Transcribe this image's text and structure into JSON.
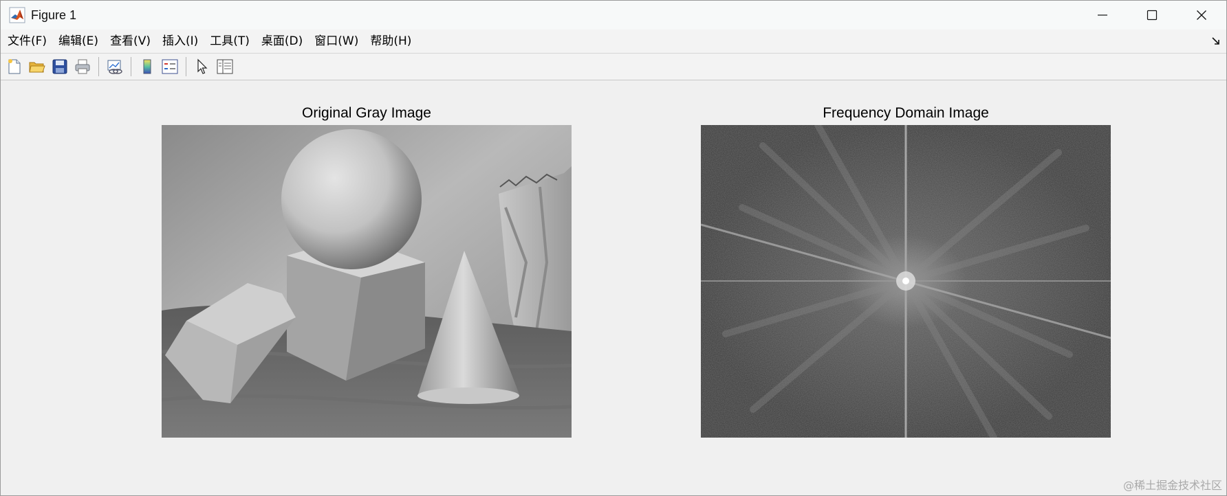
{
  "window": {
    "title": "Figure 1"
  },
  "menubar": {
    "items": [
      {
        "label": "文件(F)"
      },
      {
        "label": "编辑(E)"
      },
      {
        "label": "查看(V)"
      },
      {
        "label": "插入(I)"
      },
      {
        "label": "工具(T)"
      },
      {
        "label": "桌面(D)"
      },
      {
        "label": "窗口(W)"
      },
      {
        "label": "帮助(H)"
      }
    ]
  },
  "toolbar": {
    "icons": [
      "new-figure-icon",
      "open-file-icon",
      "save-icon",
      "print-icon",
      "link-plot-icon",
      "insert-colorbar-icon",
      "insert-legend-icon",
      "edit-plot-icon",
      "property-inspector-icon"
    ]
  },
  "plots": [
    {
      "title": "Original Gray Image"
    },
    {
      "title": "Frequency Domain Image"
    }
  ],
  "watermark": "@稀土掘金技术社区"
}
